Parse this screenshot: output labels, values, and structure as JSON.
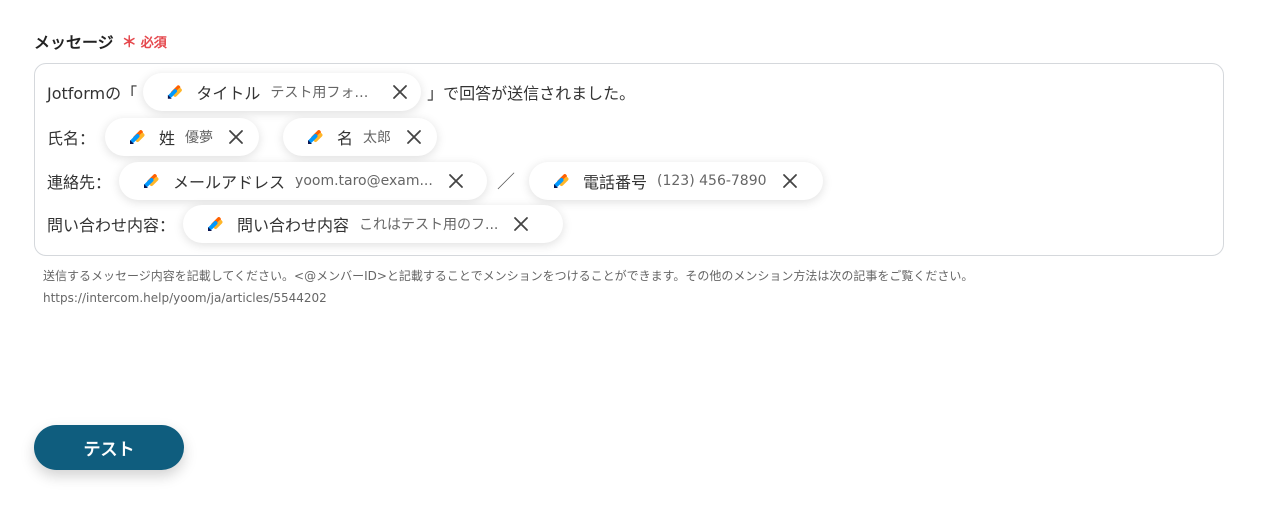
{
  "field": {
    "label": "メッセージ",
    "required_mark": "＊",
    "required_text": "必須"
  },
  "message": {
    "line1": {
      "prefix": "Jotformの「",
      "chip": {
        "name": "タイトル",
        "sample": "テスト用フォーム",
        "icon": "jotform-icon"
      },
      "suffix": "」で回答が送信されました。"
    },
    "line2": {
      "prefix": "氏名：",
      "chip_last": {
        "name": "姓",
        "sample": "優夢",
        "icon": "jotform-icon"
      },
      "chip_first": {
        "name": "名",
        "sample": "太郎",
        "icon": "jotform-icon"
      }
    },
    "line3": {
      "prefix": "連絡先：",
      "chip_email": {
        "name": "メールアドレス",
        "sample": "yoom.taro@exam...",
        "icon": "jotform-icon"
      },
      "separator": "／",
      "chip_phone": {
        "name": "電話番号",
        "sample": "(123) 456-7890",
        "icon": "jotform-icon"
      }
    },
    "line4": {
      "prefix": "問い合わせ内容：",
      "chip": {
        "name": "問い合わせ内容",
        "sample": "これはテスト用のフ...",
        "icon": "jotform-icon"
      }
    }
  },
  "help": {
    "text": "送信するメッセージ内容を記載してください。<@メンバーID>と記載することでメンションをつけることができます。その他のメンション方法は次の記事をご覧ください。",
    "url": "https://intercom.help/yoom/ja/articles/5544202"
  },
  "actions": {
    "test_label": "テスト"
  },
  "colors": {
    "accent": "#0f5d7e",
    "required": "#e5484d",
    "jotform_orange": "#ff6100",
    "jotform_yellow": "#ffb629",
    "jotform_blue": "#0099ff",
    "jotform_navy": "#0a1551"
  }
}
